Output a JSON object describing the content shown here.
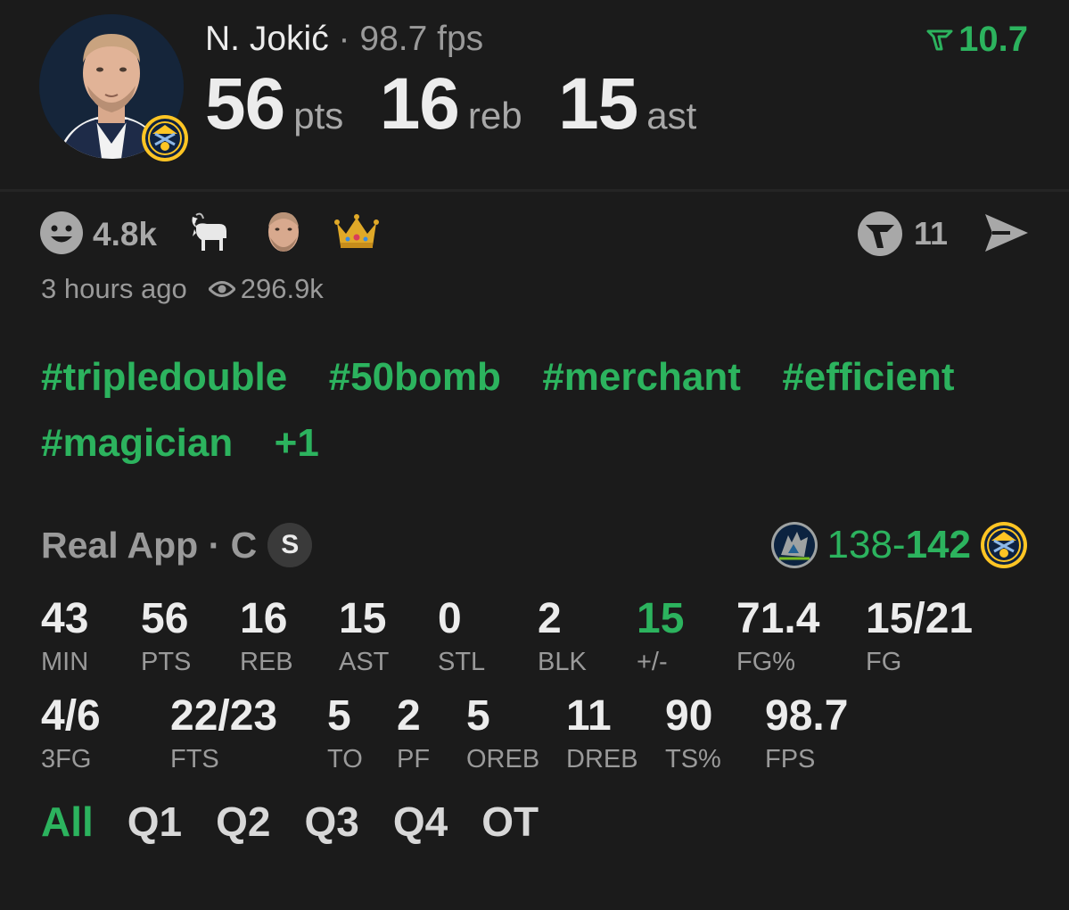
{
  "header": {
    "player_name": "N. Jokić",
    "separator": "·",
    "fantasy_points": "98.7 fps",
    "pts_value": "56",
    "pts_unit": "pts",
    "reb_value": "16",
    "reb_unit": "reb",
    "ast_value": "15",
    "ast_unit": "ast",
    "rating": "10.7"
  },
  "social": {
    "reaction_count": "4.8k",
    "emojis": [
      "goat",
      "face",
      "crown"
    ],
    "comment_count": "11",
    "posted": "3 hours ago",
    "views": "296.9k"
  },
  "tags": [
    "#tripledouble",
    "#50bomb",
    "#merchant",
    "#efficient",
    "#magician",
    "+1"
  ],
  "source": {
    "label": "Real App · C",
    "badge": "S"
  },
  "game": {
    "score_left": "138",
    "dash": "-",
    "score_right": "142"
  },
  "stats_row1": [
    {
      "value": "43",
      "label": "MIN"
    },
    {
      "value": "56",
      "label": "PTS"
    },
    {
      "value": "16",
      "label": "REB"
    },
    {
      "value": "15",
      "label": "AST"
    },
    {
      "value": "0",
      "label": "STL"
    },
    {
      "value": "2",
      "label": "BLK"
    },
    {
      "value": "15",
      "label": "+/-"
    },
    {
      "value": "71.4",
      "label": "FG%"
    },
    {
      "value": "15/21",
      "label": "FG"
    }
  ],
  "stats_row2": [
    {
      "value": "4/6",
      "label": "3FG"
    },
    {
      "value": "22/23",
      "label": "FTS"
    },
    {
      "value": "5",
      "label": "TO"
    },
    {
      "value": "2",
      "label": "PF"
    },
    {
      "value": "5",
      "label": "OREB"
    },
    {
      "value": "11",
      "label": "DREB"
    },
    {
      "value": "90",
      "label": "TS%"
    },
    {
      "value": "98.7",
      "label": "FPS"
    }
  ],
  "quarters": [
    "All",
    "Q1",
    "Q2",
    "Q3",
    "Q4",
    "OT"
  ],
  "colors": {
    "accent": "#2cb35e",
    "background": "#1b1b1b",
    "muted": "#9a9a9a",
    "nuggets_gold": "#fec524",
    "nuggets_navy": "#0e2240"
  },
  "icons": {
    "reaction": "smiley-icon",
    "comments": "comment-brand-icon",
    "share": "send-icon",
    "views": "eye-icon",
    "rating": "rating-logo-icon"
  }
}
